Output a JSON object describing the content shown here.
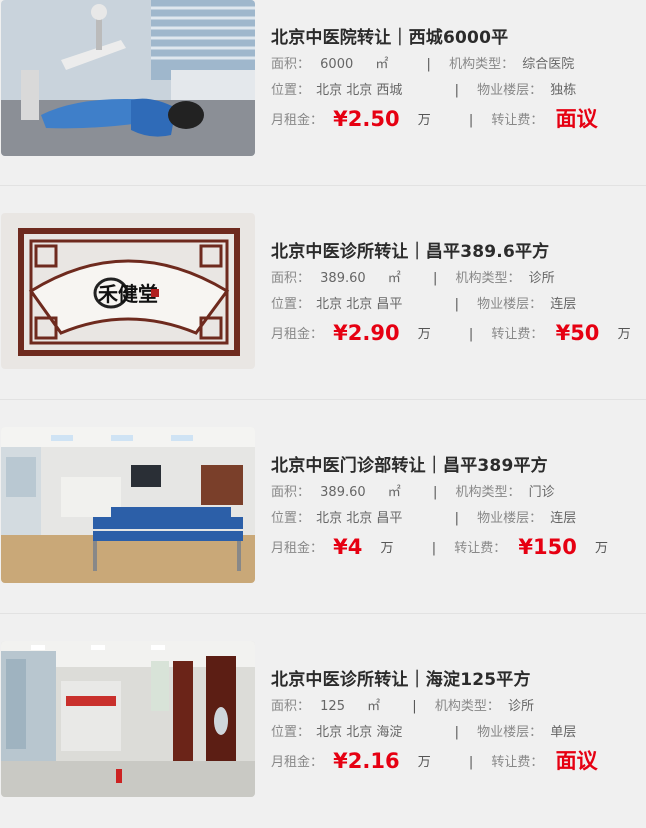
{
  "labels": {
    "area": "面积：",
    "org_type": "机构类型：",
    "location": "位置：",
    "floor": "物业楼层：",
    "rent": "月租金：",
    "transfer": "转让费：",
    "area_unit": "㎡",
    "separator": "|",
    "wan": "万"
  },
  "listings": [
    {
      "title": "北京中医院转让｜西城6000平",
      "area": "6000",
      "org_type": "综合医院",
      "location": "北京 北京 西城",
      "floor": "独栋",
      "rent": "¥2.50",
      "transfer": "面议",
      "transfer_unit": ""
    },
    {
      "title": "北京中医诊所转让｜昌平389.6平方",
      "area": "389.60",
      "org_type": "诊所",
      "location": "北京 北京 昌平",
      "floor": "连层",
      "rent": "¥2.90",
      "transfer": "¥50",
      "transfer_unit": "万"
    },
    {
      "title": "北京中医门诊部转让｜昌平389平方",
      "area": "389.60",
      "org_type": "门诊",
      "location": "北京 北京 昌平",
      "floor": "连层",
      "rent": "¥4",
      "transfer": "¥150",
      "transfer_unit": "万"
    },
    {
      "title": "北京中医诊所转让｜海淀125平方",
      "area": "125",
      "org_type": "诊所",
      "location": "北京 北京 海淀",
      "floor": "单层",
      "rent": "¥2.16",
      "transfer": "面议",
      "transfer_unit": ""
    }
  ],
  "logo_text": "禾健堂"
}
